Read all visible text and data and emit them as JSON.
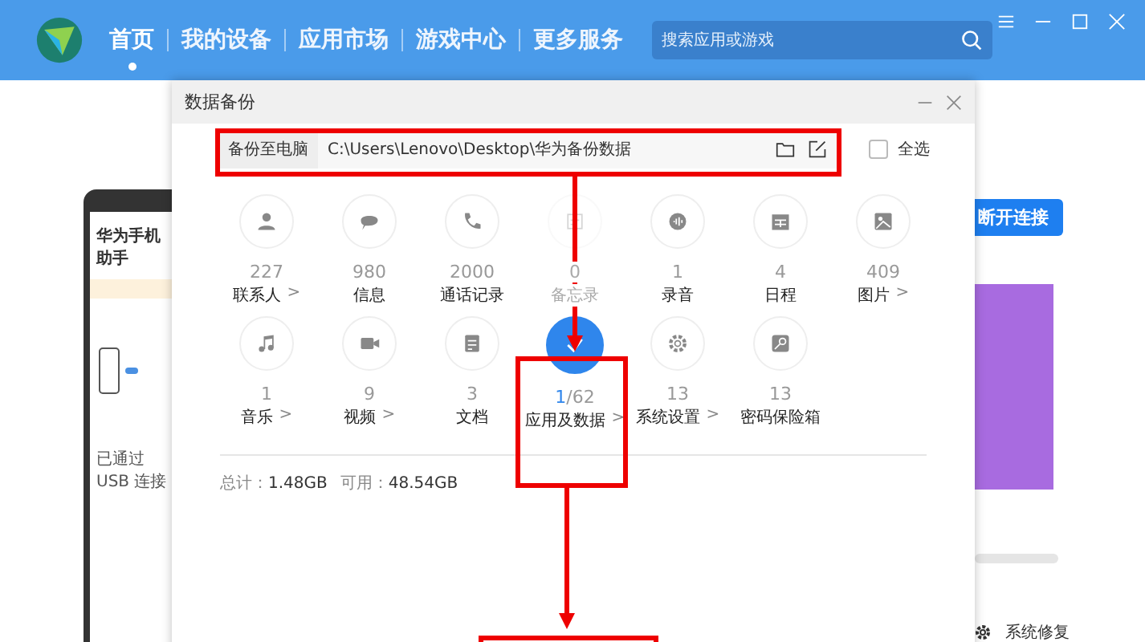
{
  "header": {
    "tabs": [
      {
        "label": "首页",
        "selected": true
      },
      {
        "label": "我的设备",
        "selected": false
      },
      {
        "label": "应用市场",
        "selected": false
      },
      {
        "label": "游戏中心",
        "selected": false
      },
      {
        "label": "更多服务",
        "selected": false
      }
    ],
    "search": {
      "placeholder": "搜索应用或游戏"
    }
  },
  "phone": {
    "title": "华为手机助手",
    "status": "已通过 USB 连接"
  },
  "right_panel": {
    "button": "断开连接",
    "repair": "系统修复"
  },
  "dialog": {
    "title": "数据备份",
    "target_label": "备份至电脑",
    "path": "C:\\Users\\Lenovo\\Desktop\\华为备份数据",
    "select_all": {
      "label": "全选",
      "checked": false
    },
    "items": [
      {
        "count": "227",
        "label": "联系人",
        "more": ">",
        "selected": false,
        "disabled": false
      },
      {
        "count": "980",
        "label": "信息",
        "selected": false,
        "disabled": false
      },
      {
        "count": "2000",
        "label": "通话记录",
        "selected": false,
        "disabled": false
      },
      {
        "count": "0",
        "label": "备忘录",
        "selected": false,
        "disabled": true
      },
      {
        "count": "1",
        "label": "录音",
        "selected": false,
        "disabled": false
      },
      {
        "count": "4",
        "label": "日程",
        "selected": false,
        "disabled": false
      },
      {
        "count": "409",
        "label": "图片",
        "more": ">",
        "selected": false,
        "disabled": false
      },
      {
        "count": "1",
        "label": "音乐",
        "more": ">",
        "selected": false,
        "disabled": false
      },
      {
        "count": "9",
        "label": "视频",
        "more": ">",
        "selected": false,
        "disabled": false
      },
      {
        "count": "3",
        "label": "文档",
        "selected": false,
        "disabled": false
      },
      {
        "count": "1",
        "total": "/62",
        "label": "应用及数据",
        "more": ">",
        "selected": true,
        "disabled": false
      },
      {
        "count": "13",
        "label": "系统设置",
        "more": ">",
        "selected": false,
        "disabled": false
      },
      {
        "count": "13",
        "label": "密码保险箱",
        "selected": false,
        "disabled": false
      }
    ],
    "total_label": "总计：",
    "total": "1.48GB",
    "free_label": "可用：",
    "free": "48.54GB"
  }
}
